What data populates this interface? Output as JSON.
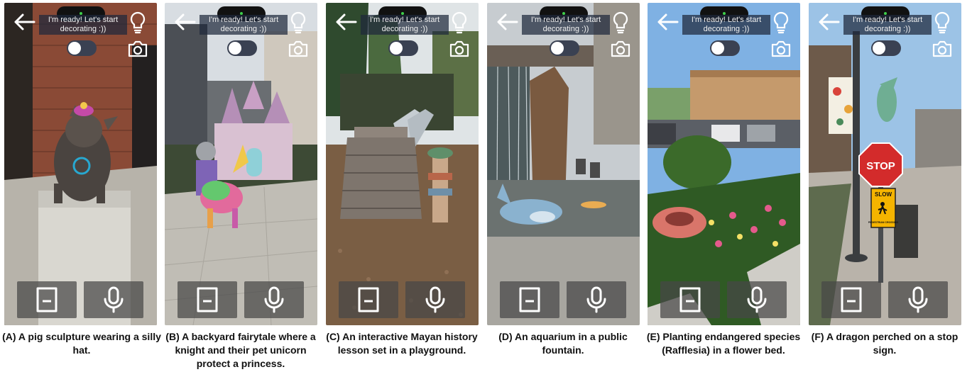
{
  "status_text": "I'm ready! Let's start decorating :))",
  "panels": [
    {
      "caption": "(A) A pig sculpture wearing a silly hat."
    },
    {
      "caption": "(B) A backyard fairytale where a knight and their pet unicorn protect a princess."
    },
    {
      "caption": "(C) An interactive Mayan history lesson set in a playground."
    },
    {
      "caption": "(D) An aquarium in a public fountain."
    },
    {
      "caption": "(E) Planting endangered species (Rafflesia) in a flower bed."
    },
    {
      "caption": "(F) A dragon perched on a stop sign."
    }
  ],
  "signs": {
    "stop": "STOP",
    "slow": "SLOW",
    "crossing": "PEDESTRIAN CROSSING"
  },
  "icons": {
    "back": "arrow-left-icon",
    "hint": "lightbulb-icon",
    "camera": "camera-icon",
    "story": "book-icon",
    "voice": "microphone-icon"
  }
}
